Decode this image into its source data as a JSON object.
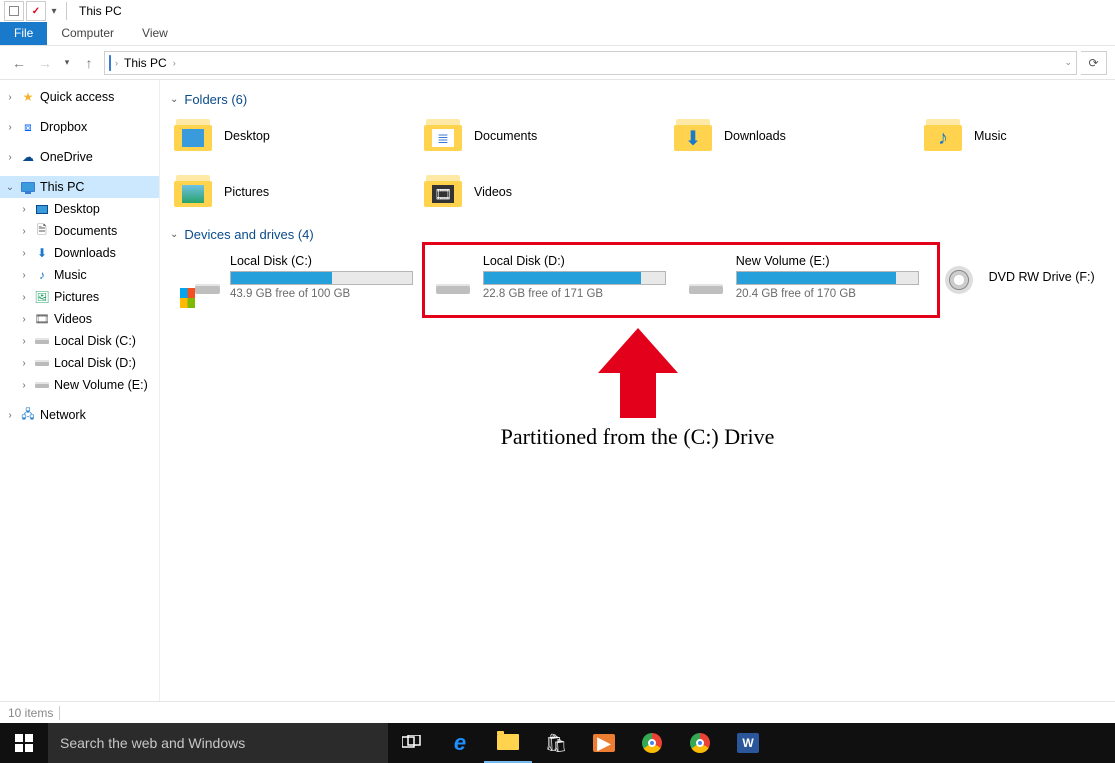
{
  "window": {
    "title": "This PC"
  },
  "ribbon": {
    "file": "File",
    "computer": "Computer",
    "view": "View"
  },
  "address": {
    "location": "This PC"
  },
  "sidebar": {
    "quick_access": "Quick access",
    "dropbox": "Dropbox",
    "onedrive": "OneDrive",
    "this_pc": "This PC",
    "children": {
      "desktop": "Desktop",
      "documents": "Documents",
      "downloads": "Downloads",
      "music": "Music",
      "pictures": "Pictures",
      "videos": "Videos",
      "local_c": "Local Disk (C:)",
      "local_d": "Local Disk (D:)",
      "new_e": "New Volume (E:)"
    },
    "network": "Network"
  },
  "sections": {
    "folders_header": "Folders (6)",
    "drives_header": "Devices and drives (4)"
  },
  "folders": {
    "desktop": "Desktop",
    "documents": "Documents",
    "downloads": "Downloads",
    "music": "Music",
    "pictures": "Pictures",
    "videos": "Videos"
  },
  "drives": {
    "c": {
      "name": "Local Disk (C:)",
      "free_text": "43.9 GB free of 100 GB",
      "used_pct": 56
    },
    "d": {
      "name": "Local Disk (D:)",
      "free_text": "22.8 GB free of 171 GB",
      "used_pct": 87
    },
    "e": {
      "name": "New Volume (E:)",
      "free_text": "20.4 GB free of 170 GB",
      "used_pct": 88
    },
    "f": {
      "name": "DVD RW Drive (F:)"
    }
  },
  "annotation": {
    "text": "Partitioned from the (C:) Drive"
  },
  "status": {
    "items": "10 items"
  },
  "taskbar": {
    "search_placeholder": "Search the web and Windows"
  }
}
